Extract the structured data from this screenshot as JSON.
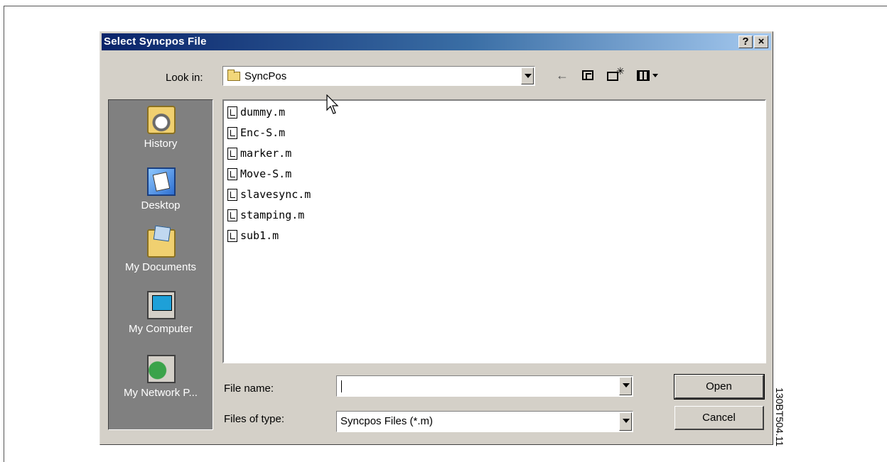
{
  "dialog": {
    "title": "Select Syncpos File",
    "help_label": "?",
    "close_label": "×"
  },
  "toolbar": {
    "look_in_label": "Look in:",
    "look_in_value": "SyncPos",
    "back_icon": "back-arrow-icon",
    "up_icon": "up-one-level-icon",
    "new_folder_icon": "new-folder-icon",
    "view_icon": "view-menu-icon"
  },
  "places": [
    {
      "label": "History",
      "icon": "history-icon"
    },
    {
      "label": "Desktop",
      "icon": "desktop-icon"
    },
    {
      "label": "My Documents",
      "icon": "my-documents-icon"
    },
    {
      "label": "My Computer",
      "icon": "my-computer-icon"
    },
    {
      "label": "My Network P...",
      "icon": "my-network-places-icon"
    }
  ],
  "files": [
    {
      "name": "dummy.m"
    },
    {
      "name": "Enc-S.m"
    },
    {
      "name": "marker.m"
    },
    {
      "name": "Move-S.m"
    },
    {
      "name": "slavesync.m"
    },
    {
      "name": "stamping.m"
    },
    {
      "name": "sub1.m"
    }
  ],
  "form": {
    "file_name_label": "File name:",
    "file_name_value": "",
    "files_of_type_label": "Files of type:",
    "files_of_type_value": "Syncpos Files (*.m)"
  },
  "buttons": {
    "open": "Open",
    "cancel": "Cancel"
  },
  "figure_code": "130BT504.11",
  "colors": {
    "titlebar_start": "#0a246a",
    "titlebar_end": "#a6caf0",
    "dialog_face": "#d4d0c8",
    "places_bar": "#808080"
  }
}
